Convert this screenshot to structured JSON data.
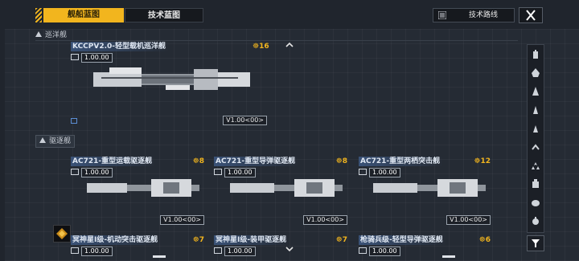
{
  "tabs": {
    "blueprint": "舰船蓝图",
    "tech": "技术蓝图"
  },
  "route_button": "技术路线",
  "sections": {
    "cruiser": "巡洋舰",
    "destroyer": "驱逐舰"
  },
  "cards": [
    {
      "title": "KCCPV2.0-轻型载机巡洋舰",
      "cost": "16",
      "version": "1.00.00",
      "tag": "V1.00<00>"
    },
    {
      "title": "AC721-重型运载驱逐舰",
      "cost": "8",
      "version": "1.00.00",
      "tag": "V1.00<00>"
    },
    {
      "title": "AC721-重型导弹驱逐舰",
      "cost": "8",
      "version": "1.00.00",
      "tag": "V1.00<00>"
    },
    {
      "title": "AC721-重型两栖突击舰",
      "cost": "12",
      "version": "1.00.00",
      "tag": "V1.00<00>"
    },
    {
      "title": "冥神星I级-机动突击驱逐舰",
      "cost": "7",
      "version": "1.00.00",
      "tag": ""
    },
    {
      "title": "冥神星I级-装甲驱逐舰",
      "cost": "7",
      "version": "1.00.00",
      "tag": ""
    },
    {
      "title": "枪骑兵级-轻型导弹驱逐舰",
      "cost": "6",
      "version": "1.00.00",
      "tag": ""
    }
  ],
  "sidebar_icons": [
    "carrier-icon",
    "battleship-icon",
    "cruiser-icon",
    "destroyer-icon",
    "frigate-icon",
    "corvette-icon",
    "fighter-icon",
    "support-icon",
    "utility-icon",
    "special-icon",
    "filter-icon"
  ],
  "colors": {
    "accent": "#f2b51e",
    "background": "#252b34",
    "title_highlight": "#3a5277"
  }
}
